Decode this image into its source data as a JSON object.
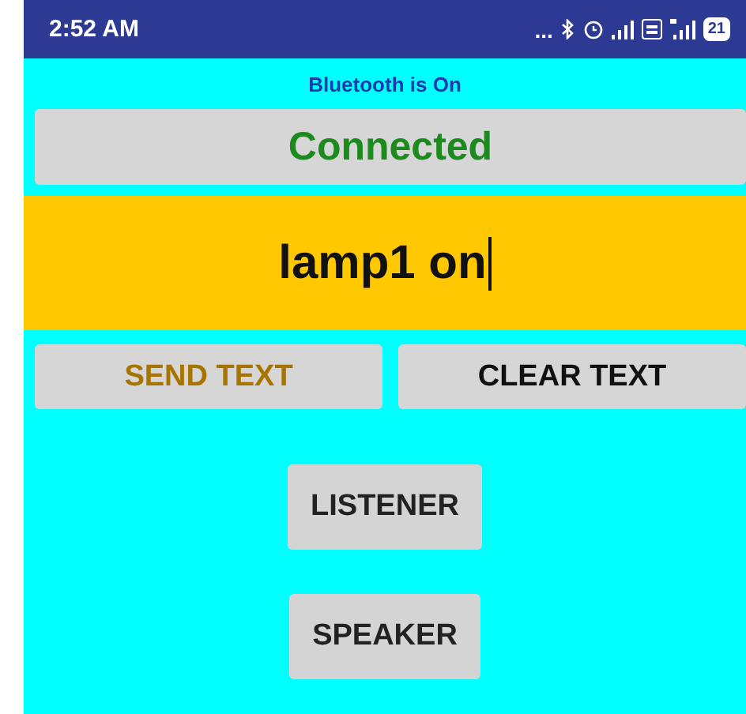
{
  "status_bar": {
    "time": "2:52 AM",
    "overflow": "...",
    "battery": "21"
  },
  "bluetooth_status": "Bluetooth is On",
  "connection_status": "Connected",
  "message_field": {
    "value": "lamp1 on",
    "focused": true
  },
  "action_buttons": [
    {
      "label": "SEND TEXT",
      "disabled": true
    },
    {
      "label": "CLEAR TEXT",
      "disabled": false
    }
  ],
  "mode_buttons": [
    {
      "label": "LISTENER"
    },
    {
      "label": "SPEAKER"
    }
  ]
}
